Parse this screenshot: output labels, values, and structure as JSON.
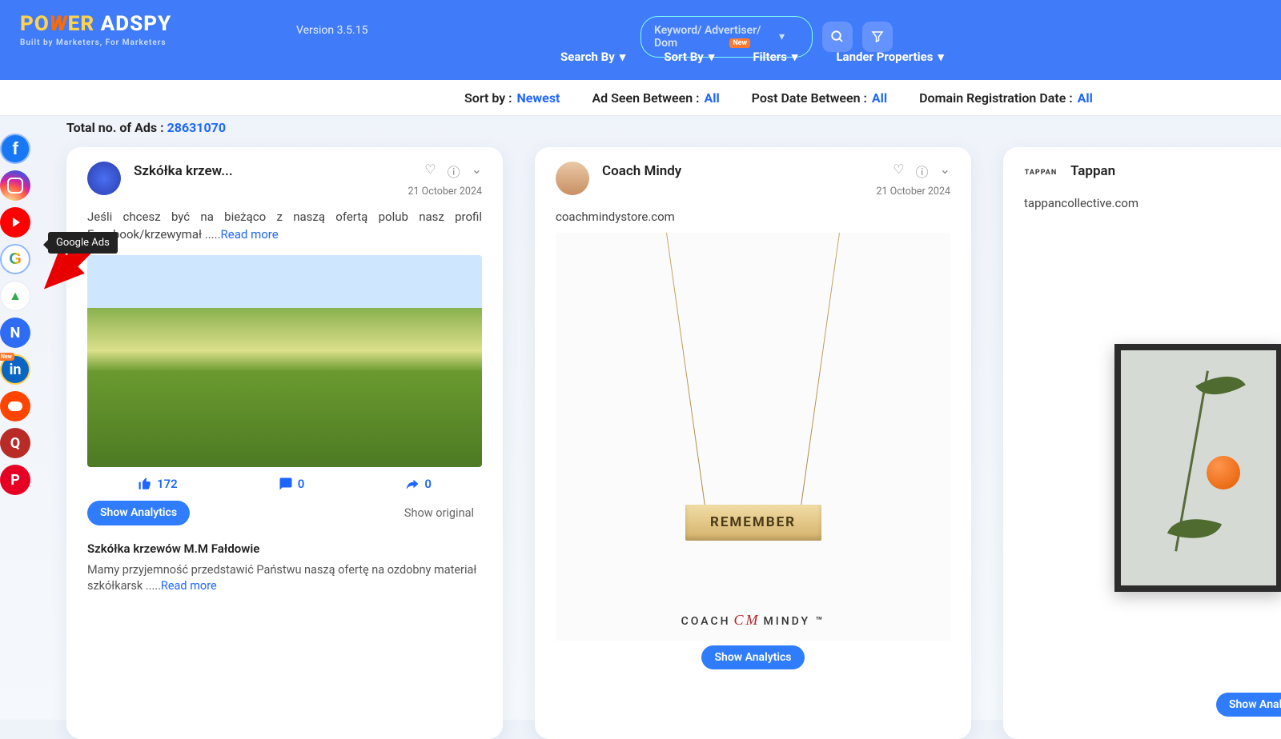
{
  "header": {
    "logo": {
      "part1": "PO",
      "part2": "W",
      "part3": "ER",
      "part4": " AD",
      "part5": "SPY"
    },
    "tagline": "Built by Marketers, For Marketers",
    "version": "Version 3.5.15",
    "search_placeholder": "Keyword/ Advertiser/ Dom",
    "nav": {
      "search_by": "Search By",
      "sort_by": "Sort By",
      "filters": "Filters",
      "lander": "Lander Properties",
      "new_badge": "New"
    }
  },
  "filter_bar": {
    "sort_label": "Sort by :",
    "sort_value": "Newest",
    "seen_label": "Ad Seen Between :",
    "seen_value": "All",
    "post_label": "Post Date Between :",
    "post_value": "All",
    "domain_label": "Domain Registration Date :",
    "domain_value": "All"
  },
  "sidebar": {
    "tooltip": "Google Ads",
    "items": [
      {
        "name": "facebook",
        "letter": "f"
      },
      {
        "name": "instagram"
      },
      {
        "name": "youtube"
      },
      {
        "name": "google",
        "letter": "G"
      },
      {
        "name": "google-ads"
      },
      {
        "name": "native",
        "letter": "N"
      },
      {
        "name": "linkedin",
        "letter": "in",
        "badge": "New"
      },
      {
        "name": "reddit"
      },
      {
        "name": "quora",
        "letter": "Q"
      },
      {
        "name": "pinterest",
        "letter": "P"
      }
    ]
  },
  "total": {
    "label": "Total no. of Ads : ",
    "value": "28631070"
  },
  "cards": [
    {
      "advertiser": "Szkółka krzew...",
      "date": "21 October 2024",
      "text": "Jeśli chcesz być na bieżąco z naszą ofertą polub nasz profil Facebook/krzewymał .....",
      "read_more": "Read more",
      "likes": "172",
      "comments": "0",
      "shares": "0",
      "show_analytics": "Show Analytics",
      "show_original": "Show original",
      "sub_title": "Szkółka krzewów M.M Fałdowie",
      "sub_desc": "Mamy przyjemność przedstawić Państwu naszą ofertę na ozdobny materiał szkółkarsk .....",
      "sub_read_more": "Read more"
    },
    {
      "advertiser": "Coach Mindy",
      "date": "21 October 2024",
      "domain": "coachmindystore.com",
      "pendant": "REMEMBER",
      "brand_left": "COACH",
      "brand_mid": "CM",
      "brand_right": "MINDY",
      "tm": "™",
      "show_analytics": "Show Analytics"
    },
    {
      "advertiser": "Tappan",
      "logo_text": "TAPPAN",
      "domain": "tappancollective.com",
      "show_analytics": "Show Analytics"
    }
  ]
}
